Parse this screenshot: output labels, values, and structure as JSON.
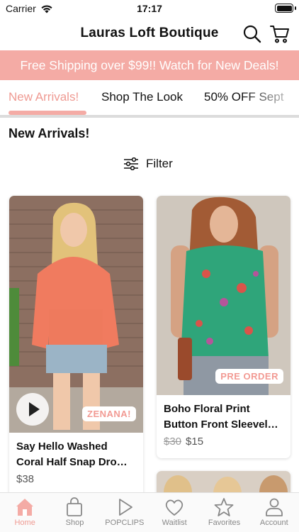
{
  "status_bar": {
    "carrier": "Carrier",
    "time": "17:17"
  },
  "header": {
    "title": "Lauras Loft Boutique"
  },
  "promo": {
    "text": "Free Shipping over $99!! Watch for New Deals!"
  },
  "tabs": [
    {
      "label": "New Arrivals!",
      "active": true
    },
    {
      "label": "Shop The Look",
      "active": false
    },
    {
      "label": "50% OFF Sept",
      "active": false
    }
  ],
  "section": {
    "title": "New Arrivals!",
    "filter_label": "Filter"
  },
  "products": [
    {
      "name": "Say Hello Washed Coral Half Snap Dro…",
      "price": "$38",
      "badge": "ZENANA!"
    },
    {
      "name": "Boho Floral Print Button Front Sleevel…",
      "old_price": "$30",
      "price": "$15",
      "badge": "PRE ORDER"
    }
  ],
  "bottom_nav": [
    {
      "label": "Home",
      "icon": "home-icon",
      "active": true
    },
    {
      "label": "Shop",
      "icon": "bag-icon",
      "active": false
    },
    {
      "label": "POPCLIPS",
      "icon": "play-icon",
      "active": false
    },
    {
      "label": "Waitlist",
      "icon": "heart-icon",
      "active": false
    },
    {
      "label": "Favorites",
      "icon": "star-icon",
      "active": false
    },
    {
      "label": "Account",
      "icon": "person-icon",
      "active": false
    }
  ],
  "colors": {
    "accent": "#f4aba5",
    "accent_text": "#ef9a92"
  }
}
